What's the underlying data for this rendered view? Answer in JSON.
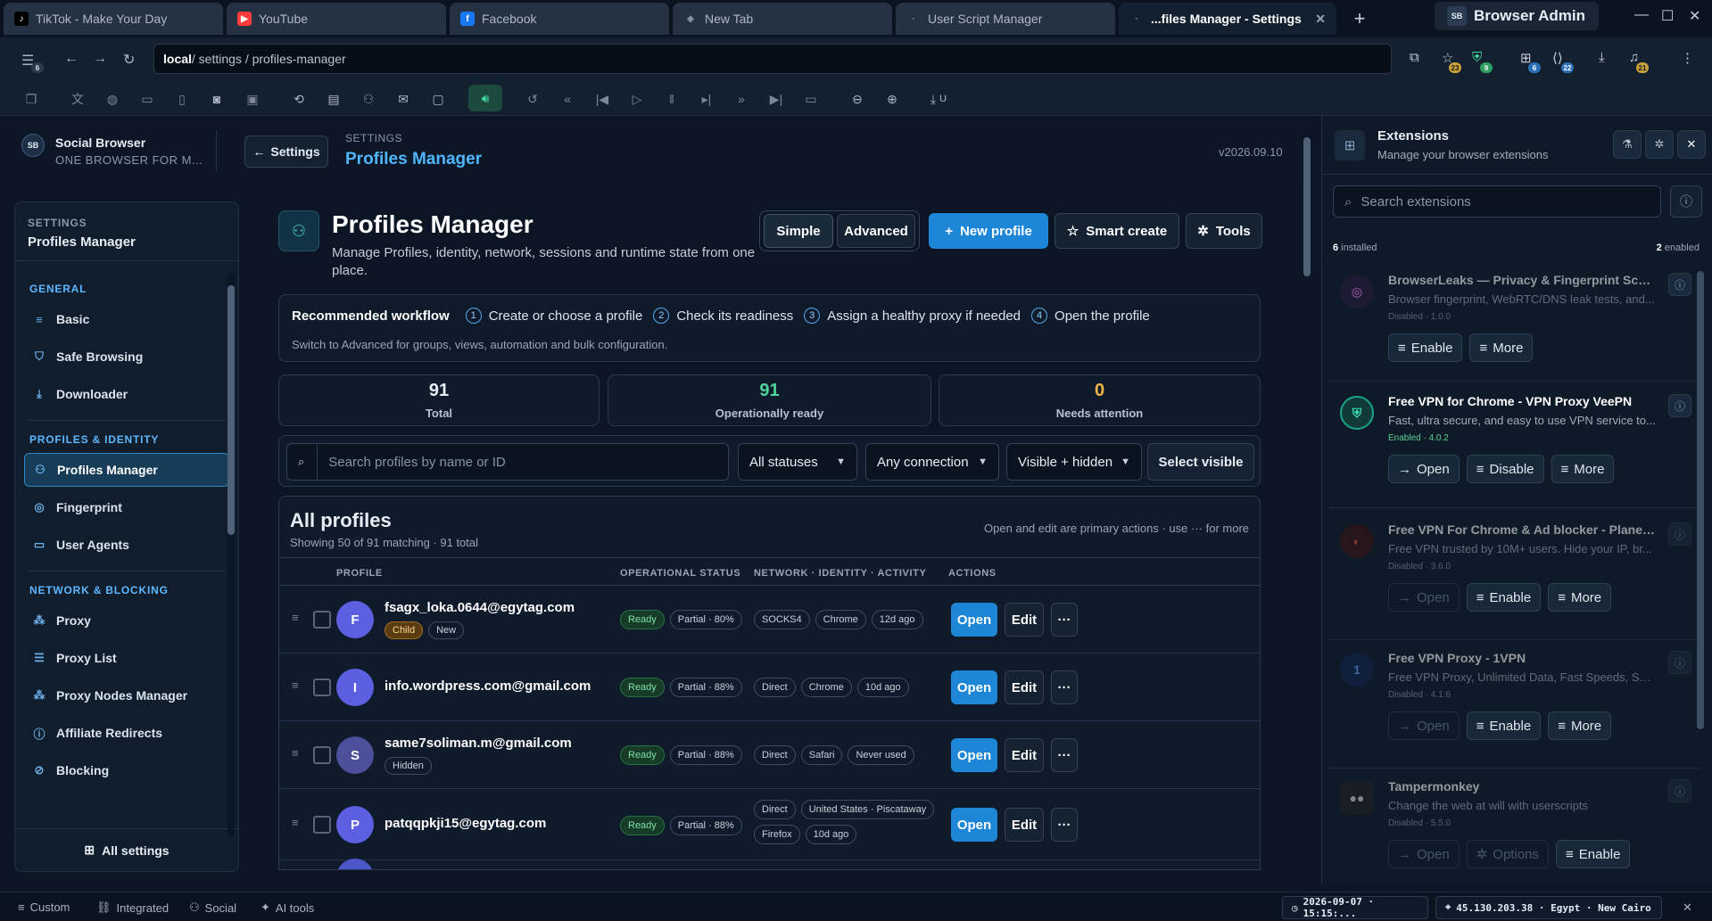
{
  "tabs": [
    {
      "label": "TikTok - Make Your Day",
      "icon": "tiktok-icon",
      "color": "#000000"
    },
    {
      "label": "YouTube",
      "icon": "youtube-icon",
      "color": "#ff3b3b"
    },
    {
      "label": "Facebook",
      "icon": "facebook-icon",
      "color": "#1877f2"
    },
    {
      "label": "New Tab",
      "icon": "shield-icon",
      "color": "#7d8896"
    },
    {
      "label": "User Script Manager",
      "icon": "dot-icon",
      "color": "#7d8896"
    },
    {
      "label": "...files Manager - Settings",
      "icon": "dot-icon",
      "color": "#7d8896"
    }
  ],
  "browser_admin": {
    "logo": "SB",
    "label": "Browser Admin"
  },
  "address": {
    "host": "local",
    "path": " / settings / profiles-manager"
  },
  "badges": {
    "star": "23",
    "shield": "9",
    "puzzle": "6",
    "code": "22",
    "bell": "21",
    "menu": "6"
  },
  "toolbar": {
    "download_label": "U"
  },
  "app": {
    "logo": "SB",
    "brand": "Social Browser",
    "tagline": "ONE BROWSER FOR M...",
    "back_label": "Settings",
    "crumb": "SETTINGS",
    "title": "Profiles Manager",
    "version": "v2026.09.10"
  },
  "sidebar": {
    "head_kicker": "SETTINGS",
    "head_title": "Profiles Manager",
    "groups": [
      {
        "label": "GENERAL",
        "items": [
          {
            "label": "Basic",
            "icon": "sliders-icon"
          },
          {
            "label": "Safe Browsing",
            "icon": "shield-icon"
          },
          {
            "label": "Downloader",
            "icon": "download-icon"
          }
        ]
      },
      {
        "label": "PROFILES & IDENTITY",
        "items": [
          {
            "label": "Profiles Manager",
            "icon": "users-icon"
          },
          {
            "label": "Fingerprint",
            "icon": "fingerprint-icon"
          },
          {
            "label": "User Agents",
            "icon": "laptop-icon"
          }
        ]
      },
      {
        "label": "NETWORK & BLOCKING",
        "items": [
          {
            "label": "Proxy",
            "icon": "network-icon"
          },
          {
            "label": "Proxy List",
            "icon": "list-icon"
          },
          {
            "label": "Proxy Nodes Manager",
            "icon": "network-icon"
          },
          {
            "label": "Affiliate Redirects",
            "icon": "info-icon"
          },
          {
            "label": "Blocking",
            "icon": "block-icon"
          }
        ]
      }
    ],
    "footer": "All settings"
  },
  "main": {
    "title": "Profiles Manager",
    "desc": "Manage Profiles, identity, network, sessions and runtime state from one place.",
    "seg": [
      "Simple",
      "Advanced"
    ],
    "buttons": {
      "new": "New profile",
      "smart": "Smart create",
      "tools": "Tools"
    },
    "workflow": {
      "lead": "Recommended workflow",
      "steps": [
        "Create or choose a profile",
        "Check its readiness",
        "Assign a healthy proxy if needed",
        "Open the profile"
      ],
      "sub": "Switch to Advanced for groups, views, automation and bulk configuration."
    },
    "stats": [
      {
        "value": "91",
        "label": "Total",
        "color": "#ffffff"
      },
      {
        "value": "91",
        "label": "Operationally ready",
        "color": "#4fd59a"
      },
      {
        "value": "0",
        "label": "Needs attention",
        "color": "#f2b34a"
      }
    ],
    "filters": {
      "search_placeholder": "Search profiles by name or ID",
      "status": "All statuses",
      "connection": "Any connection",
      "visibility": "Visible + hidden",
      "select_visible": "Select visible"
    },
    "list": {
      "title": "All profiles",
      "sub": "Showing 50 of 91 matching · 91 total",
      "hint": "Open and edit are primary actions · use ··· for more",
      "columns": [
        "PROFILE",
        "OPERATIONAL STATUS",
        "NETWORK · IDENTITY · ACTIVITY",
        "ACTIONS"
      ],
      "actions": {
        "open": "Open",
        "edit": "Edit",
        "more": "···"
      },
      "rows": [
        {
          "initial": "F",
          "name": "fsagx_loka.0644@egytag.com",
          "tags": [
            "Child",
            "New"
          ],
          "status": [
            "Ready",
            "Partial · 80%"
          ],
          "net": [
            "SOCKS4",
            "Chrome",
            "12d ago"
          ],
          "color": "#5b5fe0"
        },
        {
          "initial": "I",
          "name": "info.wordpress.com@gmail.com",
          "tags": [],
          "status": [
            "Ready",
            "Partial · 88%"
          ],
          "net": [
            "Direct",
            "Chrome",
            "10d ago"
          ],
          "color": "#5b5fe0"
        },
        {
          "initial": "S",
          "name": "same7soliman.m@gmail.com",
          "tags": [
            "Hidden"
          ],
          "status": [
            "Ready",
            "Partial · 88%"
          ],
          "net": [
            "Direct",
            "Safari",
            "Never used"
          ],
          "color": "#4c4f9a"
        },
        {
          "initial": "P",
          "name": "patqqpkji15@egytag.com",
          "tags": [],
          "status": [
            "Ready",
            "Partial · 88%"
          ],
          "net": [
            "Direct",
            "United States · Piscataway",
            "Firefox",
            "10d ago"
          ],
          "color": "#5b5fe0"
        }
      ]
    }
  },
  "extensions": {
    "title": "Extensions",
    "sub": "Manage your browser extensions",
    "search_placeholder": "Search extensions",
    "installed_count": "6",
    "installed_label": " installed",
    "enabled_count": "2",
    "enabled_label": " enabled",
    "items": [
      {
        "name": "BrowserLeaks — Privacy & Fingerprint Scan...",
        "desc": "Browser fingerprint, WebRTC/DNS leak tests, and...",
        "status": "Disabled · 1.0.0",
        "enabled": false,
        "buttons": [
          "Enable",
          "More"
        ],
        "icon": "fingerprint-icon",
        "color": "#7a3aa8"
      },
      {
        "name": "Free VPN for Chrome - VPN Proxy VeePN",
        "desc": "Fast, ultra secure, and easy to use VPN service to...",
        "status": "Enabled · 4.0.2",
        "enabled": true,
        "buttons": [
          "Open",
          "Disable",
          "More"
        ],
        "icon": "vpn-shield-icon",
        "color": "#1aa38a"
      },
      {
        "name": "Free VPN For Chrome & Ad blocker - Planet...",
        "desc": "Free VPN trusted by 10M+ users. Hide your IP, br...",
        "status": "Disabled · 3.6.0",
        "enabled": false,
        "buttons": [
          "Open",
          "Enable",
          "More"
        ],
        "icon": "planet-icon",
        "color": "#c0392b"
      },
      {
        "name": "Free VPN Proxy - 1VPN",
        "desc": "Free VPN Proxy, Unlimited Data, Fast Speeds, Sec...",
        "status": "Disabled · 4.1.6",
        "enabled": false,
        "buttons": [
          "Open",
          "Enable",
          "More"
        ],
        "icon": "shield-1-icon",
        "color": "#1f4fa8"
      },
      {
        "name": "Tampermonkey",
        "desc": "Change the web at will with userscripts",
        "status": "Disabled · 5.5.0",
        "enabled": false,
        "buttons": [
          "Open",
          "Options",
          "Enable"
        ],
        "icon": "tampermonkey-icon",
        "color": "#222222"
      }
    ]
  },
  "statusbar": {
    "custom": "Custom",
    "integrated": "Integrated",
    "social": "Social",
    "ai": "AI tools",
    "time": "2026-09-07 · 15:15:...",
    "ip": "45.130.203.38 · Egypt · New Cairo"
  }
}
